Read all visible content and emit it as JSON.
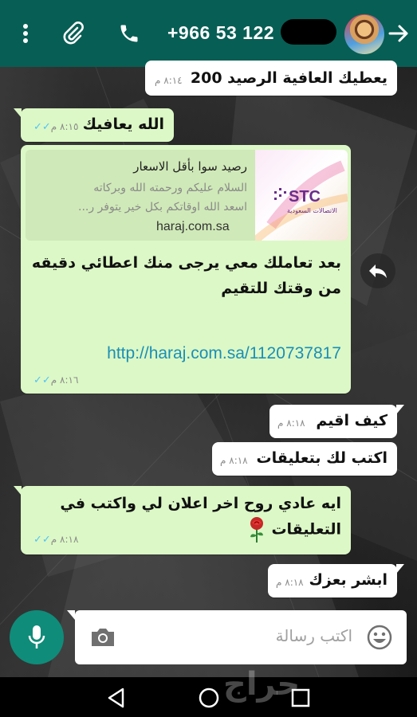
{
  "header": {
    "contact": "+966 53 122",
    "icons": [
      "more-vert-icon",
      "attach-icon",
      "phone-icon",
      "back-arrow-icon"
    ]
  },
  "messages": [
    {
      "id": "m0",
      "dir": "in",
      "text": "يعطيك العافية الرصيد 200",
      "time": "٨:١٤ م"
    },
    {
      "id": "m1",
      "dir": "out",
      "text": "الله يعافيك",
      "time": "٨:١٥ م",
      "status": "read"
    },
    {
      "id": "m2",
      "dir": "out",
      "preview": {
        "title": "رصيد سوا بأقل الاسعار",
        "desc_line1": "السلام عليكم ورحمته الله وبركاته",
        "desc_line2": "اسعد الله اوقاتكم بكل خير يتوفر ر...",
        "domain": "haraj.com.sa",
        "brand": "STC",
        "brand_sub": "الاتصالات السعودية"
      },
      "text_line1": "بعد تعاملك معي يرجى منك اعطائي دقيقه",
      "text_line2": "من وقتك للتقيم",
      "link": "http://haraj.com.sa/1120737817",
      "time": "٨:١٦ م",
      "status": "read"
    },
    {
      "id": "m3",
      "dir": "in",
      "text": "كيف اقيم",
      "time": "٨:١٨ م"
    },
    {
      "id": "m4",
      "dir": "in",
      "text": "اكتب لك بتعليقات",
      "time": "٨:١٨ م"
    },
    {
      "id": "m5",
      "dir": "out",
      "text_line1": "ايه عادي روح اخر اعلان لي واكتب في",
      "text_line2": "التعليقات",
      "time": "٨:١٨ م",
      "status": "read"
    },
    {
      "id": "m6",
      "dir": "in",
      "text": "ابشر بعزك",
      "time": "٨:١٨ م"
    }
  ],
  "composer": {
    "placeholder": "اكتب رسالة"
  },
  "watermark": "حراج",
  "colors": {
    "header": "#075e54",
    "outgoing": "#dcf8c6",
    "incoming": "#ffffff",
    "accent": "#0f8c7a",
    "read_ticks": "#4fc3f7"
  }
}
